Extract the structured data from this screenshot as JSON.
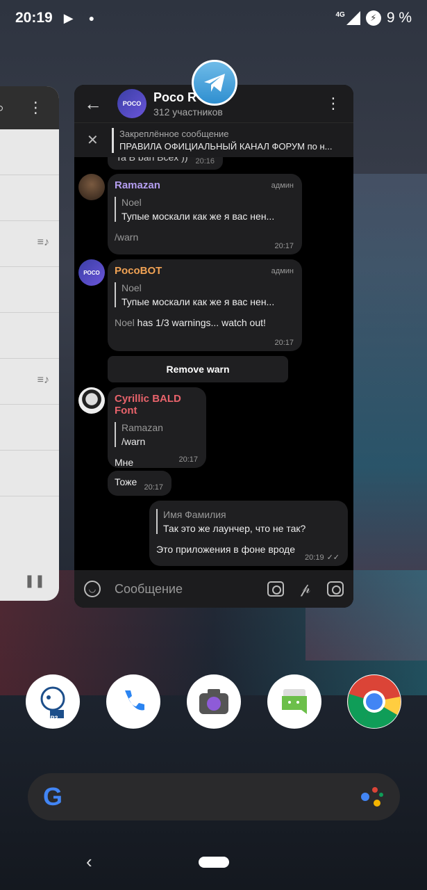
{
  "status_bar": {
    "time": "20:19",
    "network": "4G",
    "battery_percent": "9 %"
  },
  "chat": {
    "group_name": "Poco R",
    "group_avatar_text": "POCO",
    "members": "312 участников",
    "pinned_title": "Закреплённое сообщение",
    "pinned_text": "ПРАВИЛА ОФИЦИАЛЬНЫЙ КАНАЛ ФОРУМ по н...",
    "peek_text": "Ta B ban Bcex ))",
    "peek_time": "20:16",
    "messages": [
      {
        "sender": "Ramazan",
        "sender_color": "#b49ef0",
        "role": "админ",
        "reply_name": "Noel",
        "reply_text": "Тупые москали как же я вас нен...",
        "text": "/warn",
        "time": "20:17"
      },
      {
        "sender": "PocoBOT",
        "sender_color": "#f0a254",
        "role": "админ",
        "reply_name": "Noel",
        "reply_text": "Тупые москали как же я вас нен...",
        "text_name": "Noel",
        "text": " has 1/3 warnings... watch out!",
        "time": "20:17"
      },
      {
        "sender": "Cyrillic BALD Font",
        "sender_color": "#e8636b",
        "reply_name": "Ramazan",
        "reply_text": "/warn",
        "text": "Мне",
        "time": "20:17"
      },
      {
        "text": "Тоже",
        "time": "20:17"
      }
    ],
    "remove_warn_button": "Remove warn",
    "own_message": {
      "reply_name": "Имя Фамилия",
      "reply_text": "Так это же лаунчер, что не так?",
      "text": "Это приложения в фоне вроде",
      "time": "20:19"
    },
    "composer_placeholder": "Сообщение"
  },
  "dock": {
    "apps": [
      "VK MP3",
      "Phone",
      "Camera",
      "Messages",
      "Chrome"
    ],
    "mp3_label": "MP3"
  },
  "search": {
    "logo": "G"
  }
}
